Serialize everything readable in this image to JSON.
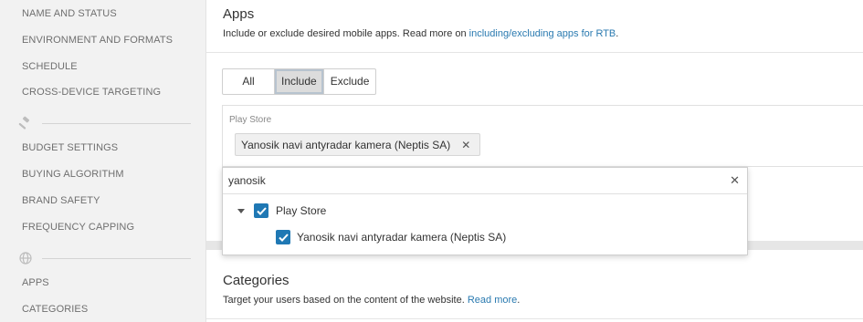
{
  "sidebar": {
    "items_top": [
      "NAME AND STATUS",
      "ENVIRONMENT AND FORMATS",
      "SCHEDULE",
      "CROSS-DEVICE TARGETING"
    ],
    "items_mid": [
      "BUDGET SETTINGS",
      "BUYING ALGORITHM",
      "BRAND SAFETY",
      "FREQUENCY CAPPING"
    ],
    "items_bottom": [
      "APPS",
      "CATEGORIES"
    ]
  },
  "apps": {
    "title": "Apps",
    "desc_prefix": "Include or exclude desired mobile apps. Read more on ",
    "desc_link": "including/excluding apps for RTB",
    "desc_suffix": ".",
    "modes": [
      "All",
      "Include",
      "Exclude"
    ],
    "selected_mode": "Include",
    "store_label": "Play Store",
    "selected_tag": "Yanosik navi antyradar kamera (Neptis SA)"
  },
  "dropdown": {
    "query": "yanosik",
    "store": "Play Store",
    "app": "Yanosik navi antyradar kamera (Neptis SA)"
  },
  "categories": {
    "title": "Categories",
    "desc_prefix": "Target your users based on the content of the website. ",
    "desc_link": "Read more",
    "desc_suffix": "."
  },
  "colors": {
    "accent": "#1f78b4",
    "link": "#2a7ab0"
  }
}
